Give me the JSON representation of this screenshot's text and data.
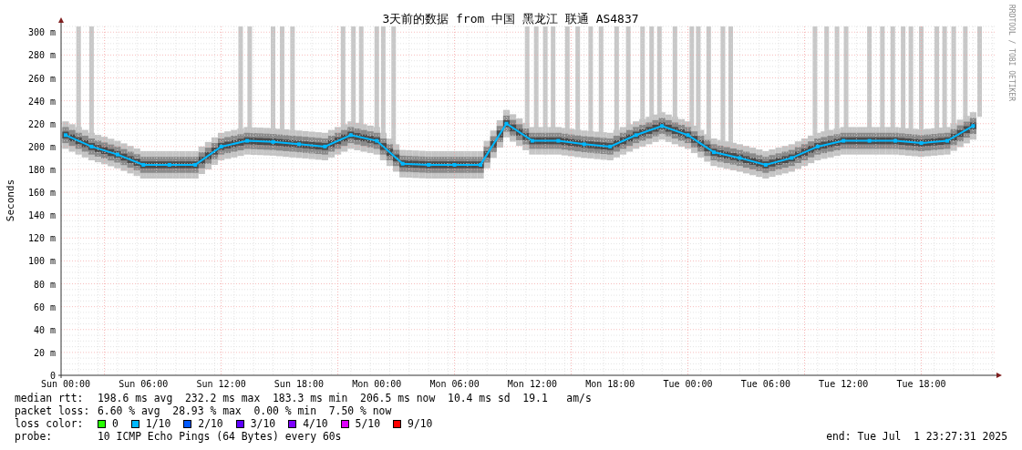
{
  "chart": {
    "credit": "RRDTOOL / TOBI OETIKER",
    "chart_data": {
      "type": "line",
      "title": "3天前的数据 from 中国 黑龙江 联通 AS4837",
      "ylabel": "Seconds",
      "grid": true,
      "categories": [
        "Sun 00:00",
        null,
        null,
        "Sun 06:00",
        null,
        null,
        "Sun 12:00",
        null,
        null,
        "Sun 18:00",
        null,
        null,
        "Mon 00:00",
        null,
        null,
        "Mon 06:00",
        null,
        null,
        "Mon 12:00",
        null,
        null,
        "Mon 18:00",
        null,
        null,
        "Tue 00:00",
        null,
        null,
        "Tue 06:00",
        null,
        null,
        "Tue 12:00",
        null,
        null,
        "Tue 18:00",
        null,
        null
      ],
      "series": [
        {
          "color": "#00b8ff",
          "marker": "square",
          "values": [
            210,
            200,
            193,
            184,
            184,
            184,
            200,
            205,
            204,
            202,
            200,
            210,
            205,
            185,
            184,
            184,
            184,
            220,
            205,
            205,
            202,
            200,
            210,
            218,
            210,
            195,
            190,
            184,
            190,
            200,
            205,
            205,
            205,
            203,
            205,
            218
          ]
        }
      ],
      "ylim": [
        0,
        305
      ],
      "yticks": [
        {
          "value": 0,
          "label": "0"
        },
        {
          "value": 20,
          "label": "20 m"
        },
        {
          "value": 40,
          "label": "40 m"
        },
        {
          "value": 60,
          "label": "60 m"
        },
        {
          "value": 80,
          "label": "80 m"
        },
        {
          "value": 100,
          "label": "100 m"
        },
        {
          "value": 120,
          "label": "120 m"
        },
        {
          "value": 140,
          "label": "140 m"
        },
        {
          "value": 160,
          "label": "160 m"
        },
        {
          "value": 180,
          "label": "180 m"
        },
        {
          "value": 200,
          "label": "200 m"
        },
        {
          "value": 220,
          "label": "220 m"
        },
        {
          "value": 240,
          "label": "240 m"
        },
        {
          "value": 260,
          "label": "260 m"
        },
        {
          "value": 280,
          "label": "280 m"
        },
        {
          "value": 300,
          "label": "300 m"
        }
      ]
    }
  },
  "legend": {
    "median_rtt": {
      "label": "median rtt:",
      "value": "198.6 ms avg  232.2 ms max  183.3 ms min  206.5 ms now  10.4 ms sd  19.1   am/s"
    },
    "packet_loss": {
      "label": "packet loss:",
      "value": "6.60 % avg  28.93 % max  0.00 % min  7.50 % now"
    },
    "loss_colors": {
      "label": "loss color:",
      "items": [
        {
          "label": "0",
          "color": "#26ff00"
        },
        {
          "label": "1/10",
          "color": "#00b8ff"
        },
        {
          "label": "2/10",
          "color": "#0059ff"
        },
        {
          "label": "3/10",
          "color": "#5e00ff"
        },
        {
          "label": "4/10",
          "color": "#7e00ff"
        },
        {
          "label": "5/10",
          "color": "#dd00ff"
        },
        {
          "label": "9/10",
          "color": "#ff0000"
        }
      ]
    },
    "probe": {
      "label": "probe:",
      "value": "10 ICMP Echo Pings (64 Bytes) every 60s"
    },
    "end": "end: Tue Jul  1 23:27:31 2025"
  }
}
